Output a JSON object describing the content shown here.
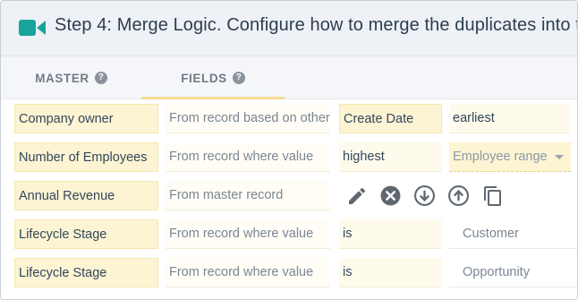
{
  "header": {
    "title": "Step 4: Merge Logic. Configure how to merge the duplicates into t",
    "icon": "video-camera-icon",
    "accent": "#1aa39b"
  },
  "tabs": [
    {
      "label": "MASTER",
      "active": false
    },
    {
      "label": "FIELDS",
      "active": true
    }
  ],
  "help_glyph": "?",
  "rows": [
    {
      "field": "Company owner",
      "rule": "From record based on other",
      "operand": "Create Date",
      "value": "earliest"
    },
    {
      "field": "Number of Employees",
      "rule": "From record where value",
      "operand": "highest",
      "select": "Employee range"
    },
    {
      "field": "Annual Revenue",
      "rule": "From master record",
      "actions": [
        "edit-icon",
        "remove-icon",
        "move-down-icon",
        "move-up-icon",
        "copy-icon"
      ]
    },
    {
      "field": "Lifecycle Stage",
      "rule": "From record where value",
      "operand": "is",
      "value": "Customer"
    },
    {
      "field": "Lifecycle Stage",
      "rule": "From record where value",
      "operand": "is",
      "value": "Opportunity"
    }
  ],
  "colors": {
    "field_bg": "#fdf4d3",
    "header_bg": "#eef1f5",
    "tab_underline": "#f5dd93",
    "icon_gray": "#5f6770"
  }
}
